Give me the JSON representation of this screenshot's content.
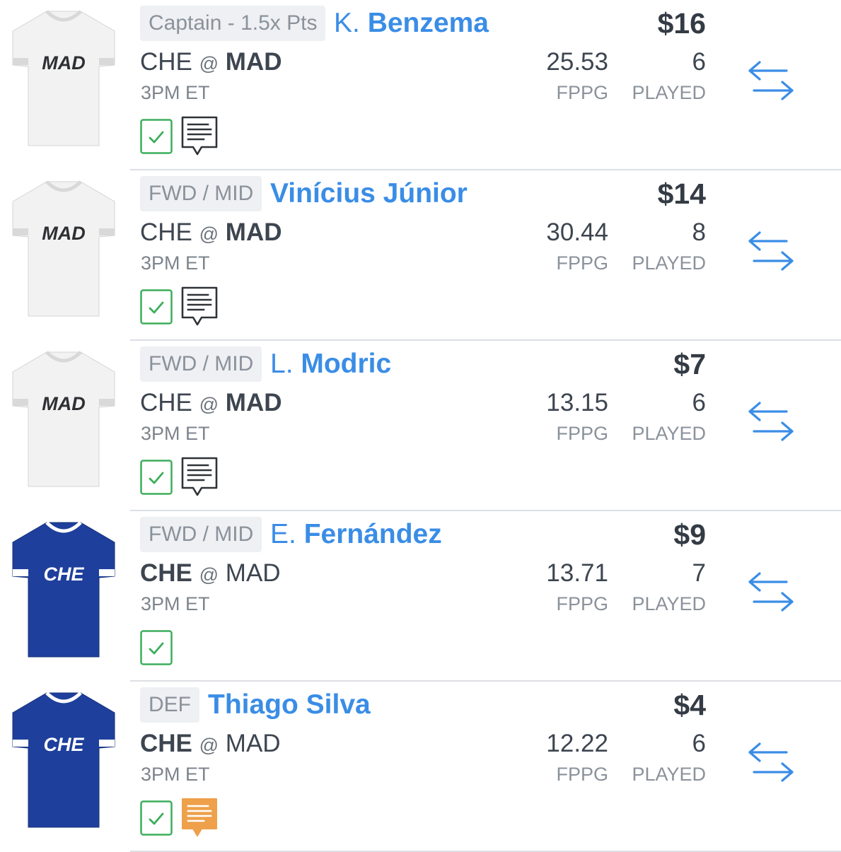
{
  "colors": {
    "accent": "#3a8de6",
    "check": "#3cae5b",
    "note_highlight": "#eea04a",
    "mad_jersey": "#f2f2f2",
    "che_jersey": "#1e3f9c"
  },
  "icons": {
    "swap": "swap-arrows-icon",
    "check": "checkbox-checked-icon",
    "note": "news-note-icon"
  },
  "players": [
    {
      "badge": "Captain - 1.5x Pts",
      "first": "K.",
      "last": "Benzema",
      "salary": "$16",
      "home": "CHE",
      "at": "@",
      "away": "MAD",
      "bold_team": "away",
      "time": "3PM ET",
      "fppg": "25.53",
      "fppg_label": "FPPG",
      "played": "6",
      "played_label": "PLAYED",
      "jersey": "MAD",
      "note": "standard"
    },
    {
      "badge": "FWD / MID",
      "first": "",
      "last": "Vinícius Júnior",
      "salary": "$14",
      "home": "CHE",
      "at": "@",
      "away": "MAD",
      "bold_team": "away",
      "time": "3PM ET",
      "fppg": "30.44",
      "fppg_label": "FPPG",
      "played": "8",
      "played_label": "PLAYED",
      "jersey": "MAD",
      "note": "standard"
    },
    {
      "badge": "FWD / MID",
      "first": "L.",
      "last": "Modric",
      "salary": "$7",
      "home": "CHE",
      "at": "@",
      "away": "MAD",
      "bold_team": "away",
      "time": "3PM ET",
      "fppg": "13.15",
      "fppg_label": "FPPG",
      "played": "6",
      "played_label": "PLAYED",
      "jersey": "MAD",
      "note": "standard"
    },
    {
      "badge": "FWD / MID",
      "first": "E.",
      "last": "Fernández",
      "salary": "$9",
      "home": "CHE",
      "at": "@",
      "away": "MAD",
      "bold_team": "home",
      "time": "3PM ET",
      "fppg": "13.71",
      "fppg_label": "FPPG",
      "played": "7",
      "played_label": "PLAYED",
      "jersey": "CHE",
      "note": "none"
    },
    {
      "badge": "DEF",
      "first": "",
      "last": "Thiago Silva",
      "salary": "$4",
      "home": "CHE",
      "at": "@",
      "away": "MAD",
      "bold_team": "home",
      "time": "3PM ET",
      "fppg": "12.22",
      "fppg_label": "FPPG",
      "played": "6",
      "played_label": "PLAYED",
      "jersey": "CHE",
      "note": "highlight"
    }
  ]
}
